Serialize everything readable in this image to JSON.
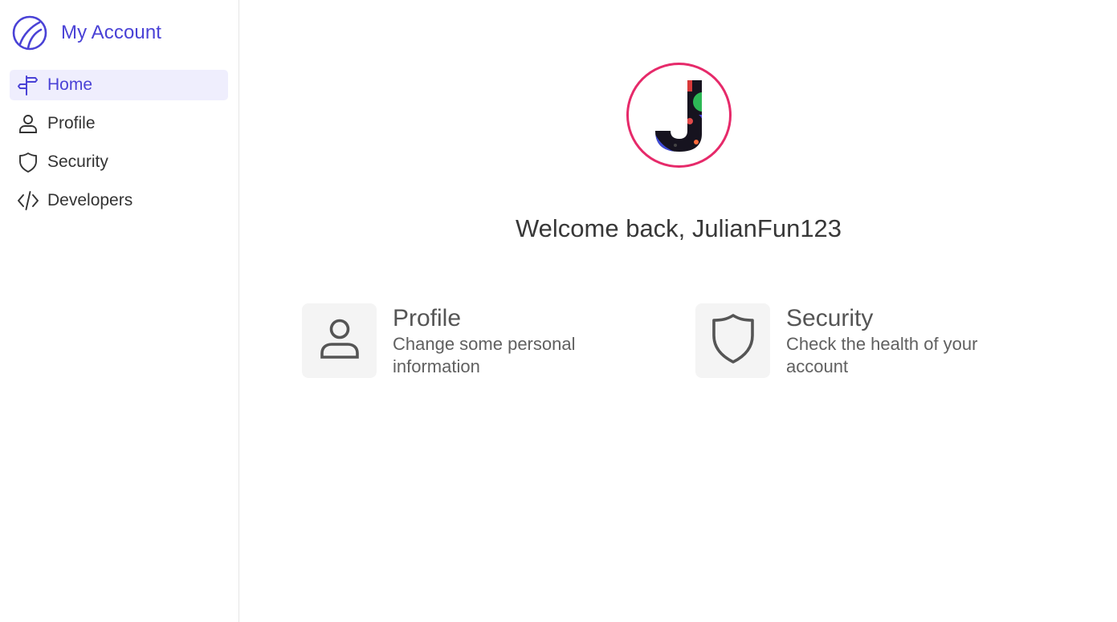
{
  "app": {
    "title": "My Account",
    "logo_icon": "brand-logo-icon",
    "accent_color": "#4a42d6"
  },
  "sidebar": {
    "items": [
      {
        "label": "Home",
        "icon": "signpost-icon",
        "active": true
      },
      {
        "label": "Profile",
        "icon": "user-icon",
        "active": false
      },
      {
        "label": "Security",
        "icon": "shield-icon",
        "active": false
      },
      {
        "label": "Developers",
        "icon": "code-icon",
        "active": false
      }
    ]
  },
  "main": {
    "avatar": {
      "initial": "J",
      "ring_color": "#e62a6a"
    },
    "welcome": "Welcome back, JulianFun123",
    "cards": [
      {
        "title": "Profile",
        "description": "Change some personal information",
        "icon": "user-icon"
      },
      {
        "title": "Security",
        "description": "Check the health of your account",
        "icon": "shield-icon"
      }
    ]
  }
}
